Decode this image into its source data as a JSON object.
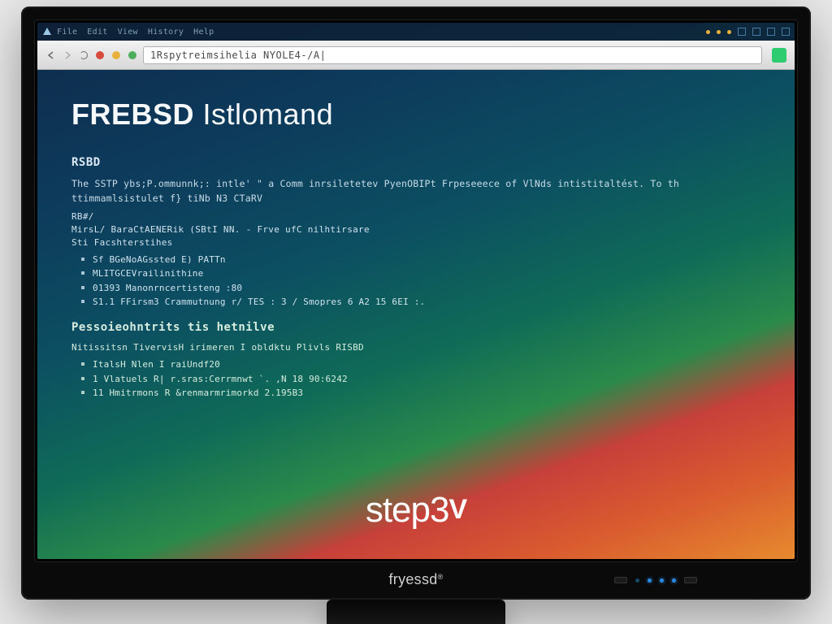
{
  "menubar": {
    "items": [
      "File",
      "Edit",
      "View",
      "History",
      "Help"
    ]
  },
  "toolbar": {
    "address_text": "1Rspytreimsihelia NYOLE4-/A|"
  },
  "page": {
    "title_bold": "FREBSD",
    "title_rest": "Istlomand",
    "sec1": {
      "heading": "RSBD",
      "para1": "The SSTP ybs;P.ommunnk;: intle' \" a Comm inrsiletetev PyenOBIPt Frpeseeece of VlNds intistitaltést. To th ttimmamlsistulet f} tiNb N3 CTaRV",
      "para2": "RB#/",
      "line1": "MirsL/ BaraCtAENERik (SBtI NN. - Frve ufC nilhtirsare",
      "line2": "Sti Facshterstihes",
      "bullets": [
        "Sf BGeNoAGssted E) PATTn",
        "MLITGCEVrailinithine",
        "01393 Manonrncertisteng :80",
        "S1.1 FFirsm3 Crammutnung r/ TES : 3 / Smopres 6   A2 15 6EI :."
      ]
    },
    "sec2": {
      "heading": "Pessoieohntrits tis hetnilve",
      "line1": "Nitissitsn     TivervisH irimeren I obldktu Plivls RISBD",
      "bullets": [
        "ItalsH Nlen I raiUndf20",
        "1 Vlatuels R| r.sras:Cerrmnwt `.    ,N 18  90:6242",
        "11 Hmitrmons R &renmarmrimorkd  2.195B3"
      ]
    }
  },
  "footer": {
    "brand_step": "step",
    "brand_three": "3",
    "brand_v": "V"
  },
  "bezel": {
    "brand": "fryessd"
  }
}
